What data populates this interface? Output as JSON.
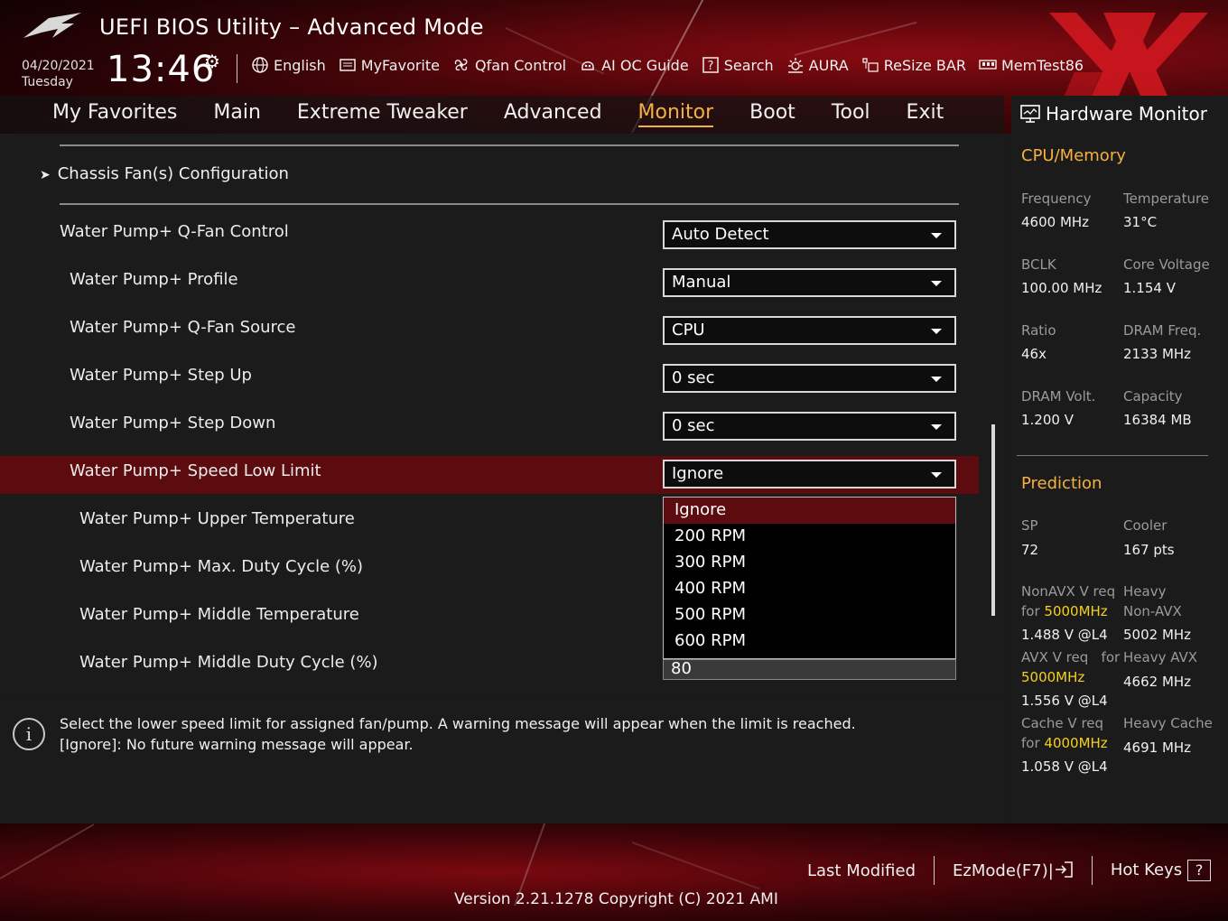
{
  "header": {
    "title": "UEFI BIOS Utility – Advanced Mode",
    "date": "04/20/2021",
    "day": "Tuesday",
    "time": "13:46",
    "toolbar": [
      {
        "label": "English",
        "icon": "globe-icon"
      },
      {
        "label": "MyFavorite",
        "icon": "favorite-icon"
      },
      {
        "label": "Qfan Control",
        "icon": "fan-icon"
      },
      {
        "label": "AI OC Guide",
        "icon": "ai-icon"
      },
      {
        "label": "Search",
        "icon": "search-icon"
      },
      {
        "label": "AURA",
        "icon": "aura-icon"
      },
      {
        "label": "ReSize BAR",
        "icon": "resize-bar-icon"
      },
      {
        "label": "MemTest86",
        "icon": "memtest-icon"
      }
    ]
  },
  "nav": {
    "tabs": [
      "My Favorites",
      "Main",
      "Extreme Tweaker",
      "Advanced",
      "Monitor",
      "Boot",
      "Tool",
      "Exit"
    ],
    "active": "Monitor"
  },
  "main": {
    "section": "Chassis Fan(s) Configuration",
    "rows": [
      {
        "label": "Water Pump+ Q-Fan Control",
        "value": "Auto Detect"
      },
      {
        "label": "Water Pump+ Profile",
        "value": "Manual"
      },
      {
        "label": "Water Pump+ Q-Fan Source",
        "value": "CPU"
      },
      {
        "label": "Water Pump+ Step Up",
        "value": "0 sec"
      },
      {
        "label": "Water Pump+ Step Down",
        "value": "0 sec"
      },
      {
        "label": "Water Pump+ Speed Low Limit",
        "value": "Ignore"
      },
      {
        "label": "Water Pump+ Upper Temperature"
      },
      {
        "label": "Water Pump+ Max. Duty Cycle (%)"
      },
      {
        "label": "Water Pump+ Middle Temperature"
      },
      {
        "label": "Water Pump+ Middle Duty Cycle (%)",
        "value": "80"
      }
    ],
    "popup_options": [
      "Ignore",
      "200 RPM",
      "300 RPM",
      "400 RPM",
      "500 RPM",
      "600 RPM"
    ],
    "popup_selected": "Ignore"
  },
  "info": {
    "line1": "Select the lower speed limit for assigned fan/pump. A warning message will appear when the limit is reached.",
    "line2": "[Ignore]: No future warning message will appear."
  },
  "hw_monitor": {
    "title": "Hardware Monitor",
    "cpu_memory": {
      "heading": "CPU/Memory",
      "items": [
        {
          "label": "Frequency",
          "value": "4600 MHz"
        },
        {
          "label": "Temperature",
          "value": "31°C"
        },
        {
          "label": "BCLK",
          "value": "100.00 MHz"
        },
        {
          "label": "Core Voltage",
          "value": "1.154 V"
        },
        {
          "label": "Ratio",
          "value": "46x"
        },
        {
          "label": "DRAM Freq.",
          "value": "2133 MHz"
        },
        {
          "label": "DRAM Volt.",
          "value": "1.200 V"
        },
        {
          "label": "Capacity",
          "value": "16384 MB"
        }
      ]
    },
    "prediction": {
      "heading": "Prediction",
      "sp_label": "SP",
      "sp_value": "72",
      "cooler_label": "Cooler",
      "cooler_value": "167 pts",
      "nonavx_label": "NonAVX V req",
      "nonavx_for": "for",
      "nonavx_freq": "5000MHz",
      "nonavx_value": "1.488 V @L4",
      "heavy_nonavx_label1": "Heavy",
      "heavy_nonavx_label2": "Non-AVX",
      "heavy_nonavx_value": "5002 MHz",
      "avx_label": "AVX V req",
      "avx_for": "for",
      "avx_freq": "5000MHz",
      "avx_value": "1.556 V @L4",
      "heavy_avx_label": "Heavy AVX",
      "heavy_avx_value": "4662 MHz",
      "cache_label": "Cache V req",
      "cache_for": "for",
      "cache_freq": "4000MHz",
      "cache_value": "1.058 V @L4",
      "heavy_cache_label": "Heavy Cache",
      "heavy_cache_value": "4691 MHz"
    }
  },
  "footer": {
    "last_modified": "Last Modified",
    "ezmode": "EzMode(F7)|",
    "hotkeys": "Hot Keys",
    "hotkeys_key": "?",
    "version": "Version 2.21.1278 Copyright (C) 2021 AMI"
  }
}
